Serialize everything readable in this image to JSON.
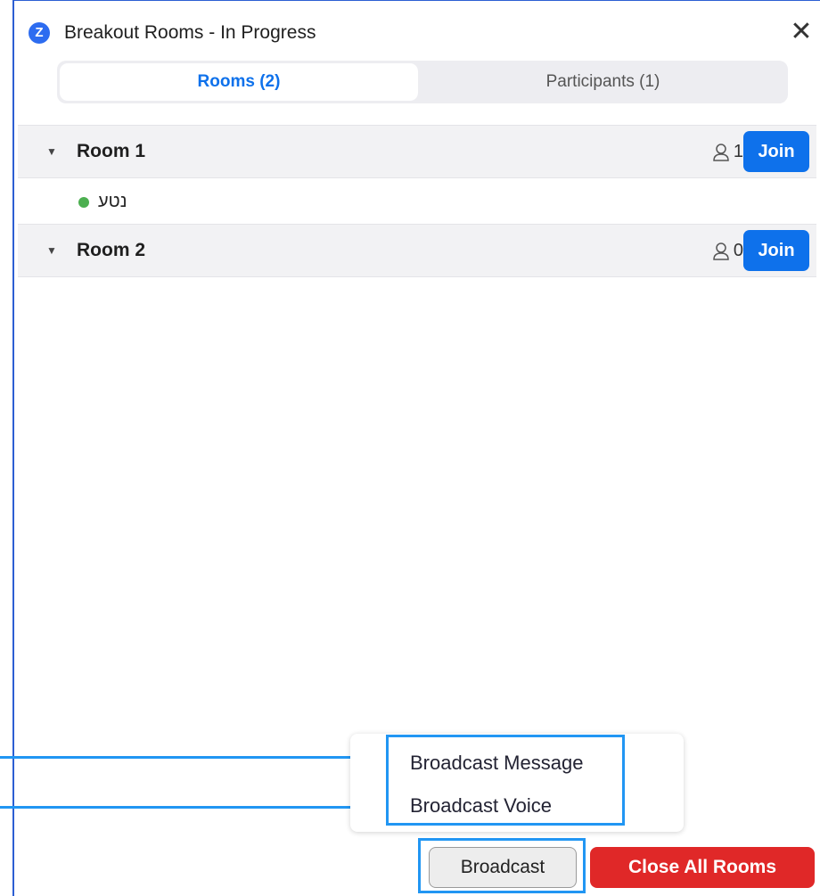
{
  "window": {
    "title": "Breakout Rooms - In Progress",
    "logo_letter": "Z",
    "close_glyph": "✕"
  },
  "tabs": [
    {
      "label": "Rooms (2)",
      "selected": true
    },
    {
      "label": "Participants (1)",
      "selected": false
    }
  ],
  "rooms": [
    {
      "name": "Room 1",
      "count": "1",
      "join_label": "Join",
      "participants": [
        "נטע"
      ]
    },
    {
      "name": "Room 2",
      "count": "0",
      "join_label": "Join",
      "participants": []
    }
  ],
  "broadcast_menu": {
    "items": [
      "Broadcast Message",
      "Broadcast Voice"
    ]
  },
  "footer": {
    "broadcast_label": "Broadcast",
    "close_all_label": "Close All Rooms"
  },
  "colors": {
    "accent": "#0e71eb",
    "danger": "#e02828",
    "highlight": "#2196f3",
    "status_online": "#4caf50"
  },
  "icons": {
    "app": "zoom-logo-icon",
    "close": "close-icon",
    "expand": "caret-down-icon",
    "person": "person-icon",
    "status": "online-dot-icon"
  }
}
